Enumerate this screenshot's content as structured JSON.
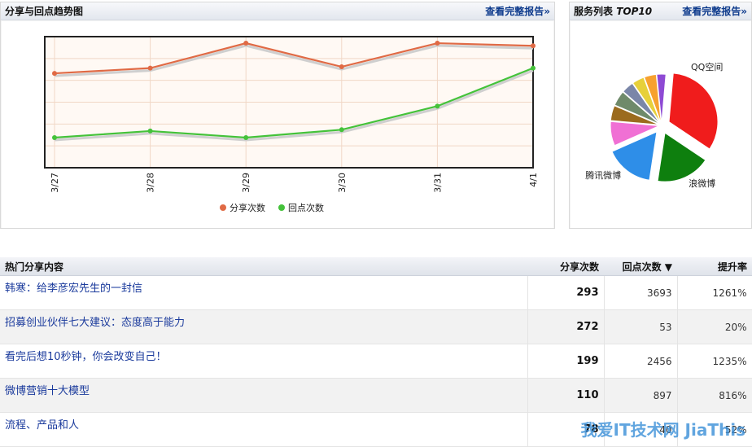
{
  "trend_panel": {
    "title": "分享与回点趋势图",
    "link": "查看完整报告»"
  },
  "services_panel": {
    "title_prefix": "服务列表 ",
    "title_emph": "TOP10",
    "link": "查看完整报告»"
  },
  "chart_data": [
    {
      "type": "line",
      "x": [
        "3/27",
        "3/28",
        "3/29",
        "3/30",
        "3/31",
        "4/1"
      ],
      "series": [
        {
          "name": "分享次数",
          "values": [
            0.72,
            0.76,
            0.95,
            0.77,
            0.95,
            0.93
          ],
          "color": "#e06a45"
        },
        {
          "name": "回点次数",
          "values": [
            0.23,
            0.28,
            0.23,
            0.29,
            0.47,
            0.76
          ],
          "color": "#44c23a"
        }
      ],
      "legend_placement": "bottom",
      "grid": true
    },
    {
      "type": "pie",
      "labels": [
        "QQ空间",
        "浪微博",
        "腾讯微博",
        "",
        "",
        "",
        "",
        "",
        "",
        ""
      ],
      "values": [
        33,
        18,
        16,
        8,
        5,
        5,
        4,
        4,
        4,
        3
      ],
      "colors": [
        "#f01c1c",
        "#0e7f0e",
        "#2e8ee8",
        "#f070d4",
        "#9b6b1e",
        "#6f8a6a",
        "#7a86a8",
        "#e7d03a",
        "#f7a12e",
        "#8e4ad4"
      ]
    }
  ],
  "table": {
    "headers": {
      "title": "热门分享内容",
      "shares": "分享次数",
      "clicks": "回点次数 ▼",
      "rate": "提升率"
    },
    "rows": [
      {
        "title": "韩寒：给李彦宏先生的一封信",
        "shares": "293",
        "clicks": "3693",
        "rate": "1261%"
      },
      {
        "title": "招募创业伙伴七大建议：态度高于能力",
        "shares": "272",
        "clicks": "53",
        "rate": "20%"
      },
      {
        "title": "看完后想10秒钟，你会改变自己！",
        "shares": "199",
        "clicks": "2456",
        "rate": "1235%"
      },
      {
        "title": "微博营销十大模型",
        "shares": "110",
        "clicks": "897",
        "rate": "816%"
      },
      {
        "title": "流程、产品和人",
        "shares": "78",
        "clicks": "40",
        "rate": "52%"
      }
    ]
  },
  "watermark": "我爱IT技术网 JiaThis"
}
